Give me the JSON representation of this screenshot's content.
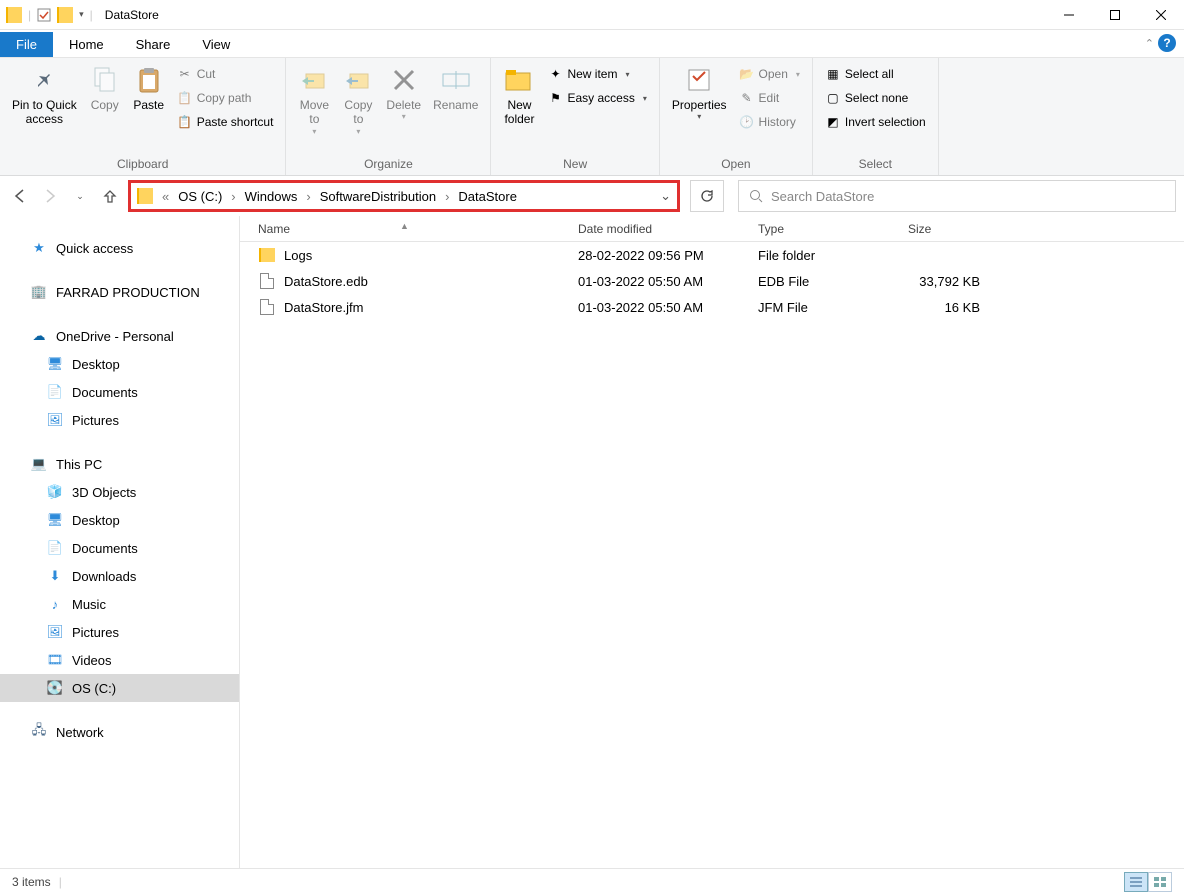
{
  "window": {
    "title": "DataStore"
  },
  "tabs": {
    "file": "File",
    "home": "Home",
    "share": "Share",
    "view": "View"
  },
  "ribbon": {
    "clipboard": {
      "label": "Clipboard",
      "pin": "Pin to Quick\naccess",
      "copy": "Copy",
      "paste": "Paste",
      "cut": "Cut",
      "copypath": "Copy path",
      "pasteshortcut": "Paste shortcut"
    },
    "organize": {
      "label": "Organize",
      "moveto": "Move\nto",
      "copyto": "Copy\nto",
      "deletebtn": "Delete",
      "rename": "Rename"
    },
    "newgrp": {
      "label": "New",
      "newfolder": "New\nfolder",
      "newitem": "New item",
      "easyaccess": "Easy access"
    },
    "opengrp": {
      "label": "Open",
      "properties": "Properties",
      "open": "Open",
      "edit": "Edit",
      "history": "History"
    },
    "selectgrp": {
      "label": "Select",
      "selectall": "Select all",
      "selectnone": "Select none",
      "invert": "Invert selection"
    }
  },
  "breadcrumb": {
    "segs": [
      "OS (C:)",
      "Windows",
      "SoftwareDistribution",
      "DataStore"
    ]
  },
  "search": {
    "placeholder": "Search DataStore"
  },
  "nav": {
    "quickaccess": "Quick access",
    "farrad": "FARRAD PRODUCTION",
    "onedrive": "OneDrive - Personal",
    "od_desktop": "Desktop",
    "od_documents": "Documents",
    "od_pictures": "Pictures",
    "thispc": "This PC",
    "pc_3d": "3D Objects",
    "pc_desktop": "Desktop",
    "pc_documents": "Documents",
    "pc_downloads": "Downloads",
    "pc_music": "Music",
    "pc_pictures": "Pictures",
    "pc_videos": "Videos",
    "pc_os": "OS (C:)",
    "network": "Network"
  },
  "columns": {
    "name": "Name",
    "date": "Date modified",
    "type": "Type",
    "size": "Size"
  },
  "files": [
    {
      "name": "Logs",
      "date": "28-02-2022 09:56 PM",
      "type": "File folder",
      "size": "",
      "icon": "folder"
    },
    {
      "name": "DataStore.edb",
      "date": "01-03-2022 05:50 AM",
      "type": "EDB File",
      "size": "33,792 KB",
      "icon": "file"
    },
    {
      "name": "DataStore.jfm",
      "date": "01-03-2022 05:50 AM",
      "type": "JFM File",
      "size": "16 KB",
      "icon": "file"
    }
  ],
  "status": {
    "items": "3 items"
  }
}
